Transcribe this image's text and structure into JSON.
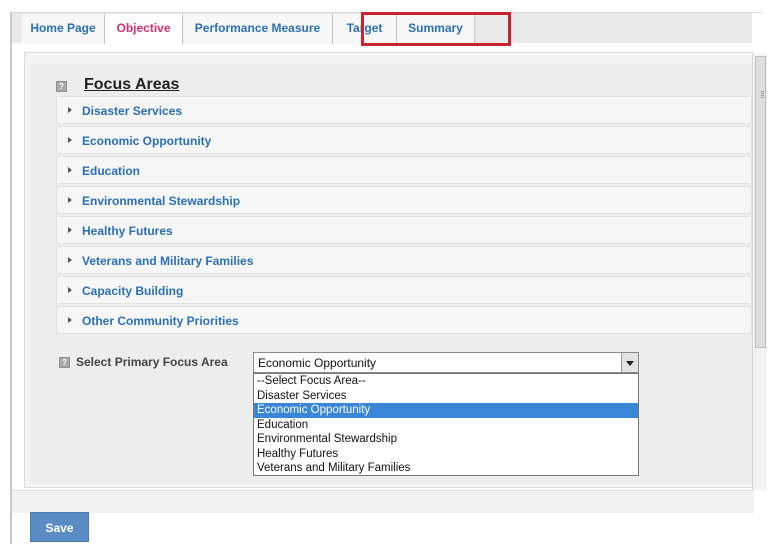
{
  "tabs": [
    {
      "label": "Home Page",
      "active": false
    },
    {
      "label": "Objective",
      "active": true
    },
    {
      "label": "Performance Measure",
      "active": false
    },
    {
      "label": "Target",
      "active": false
    },
    {
      "label": "Summary",
      "active": false
    }
  ],
  "focus_areas": {
    "title": "Focus Areas",
    "items": [
      "Disaster Services",
      "Economic Opportunity",
      "Education",
      "Environmental Stewardship",
      "Healthy Futures",
      "Veterans and Military Families",
      "Capacity Building",
      "Other Community Priorities"
    ]
  },
  "primary_focus": {
    "label": "Select Primary Focus Area",
    "selected": "Economic Opportunity",
    "options": [
      "--Select Focus Area--",
      "Disaster Services",
      "Economic Opportunity",
      "Education",
      "Environmental Stewardship",
      "Healthy Futures",
      "Veterans and Military Families"
    ]
  },
  "save_label": "Save",
  "colors": {
    "link_blue": "#2b6fb5",
    "active_tab_pink": "#cc3377",
    "highlight_red": "#c8242f",
    "selection_blue": "#3a86d6",
    "save_button": "#5b8dc4"
  }
}
